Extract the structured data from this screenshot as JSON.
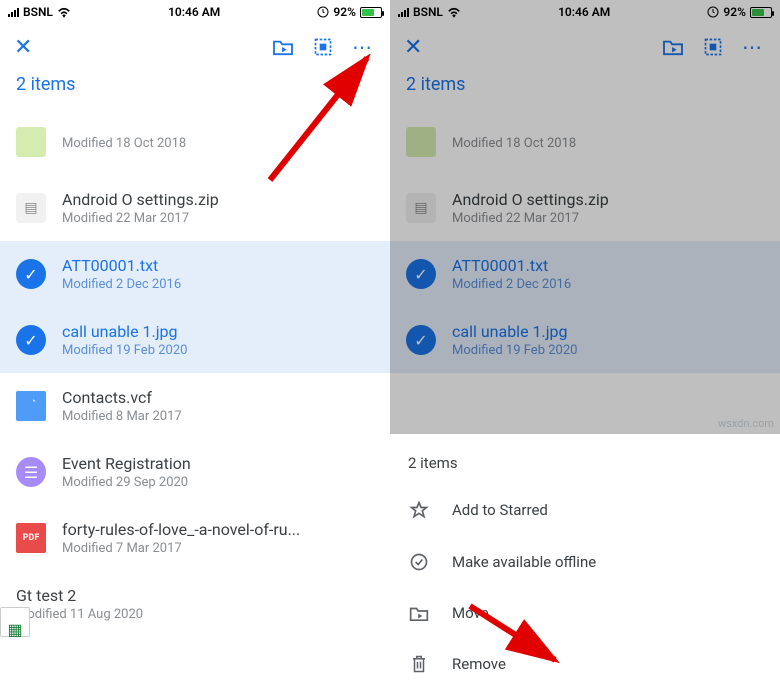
{
  "statusbar": {
    "carrier": "BSNL",
    "time": "10:46 AM",
    "battery_pct": "92%"
  },
  "left": {
    "selection_label": "2 items",
    "items": [
      {
        "name": "",
        "modified": "Modified 18 Oct 2018"
      },
      {
        "name": "Android O settings.zip",
        "modified": "Modified 22 Mar 2017"
      },
      {
        "name": "ATT00001.txt",
        "modified": "Modified 2 Dec 2016"
      },
      {
        "name": "call unable 1.jpg",
        "modified": "Modified 19 Feb 2020"
      },
      {
        "name": "Contacts.vcf",
        "modified": "Modified 8 Mar 2017"
      },
      {
        "name": "Event Registration",
        "modified": "Modified 29 Sep 2020"
      },
      {
        "name": "forty-rules-of-love_-a-novel-of-ru...",
        "modified": "Modified 7 Mar 2017"
      },
      {
        "name": "Gt test 2",
        "modified": "Modified 11 Aug 2020"
      }
    ]
  },
  "right": {
    "sheet_title": "2 items",
    "actions": {
      "star": "Add to Starred",
      "offline": "Make available offline",
      "move": "Move",
      "remove": "Remove"
    }
  },
  "watermark": "wsxdn.com"
}
